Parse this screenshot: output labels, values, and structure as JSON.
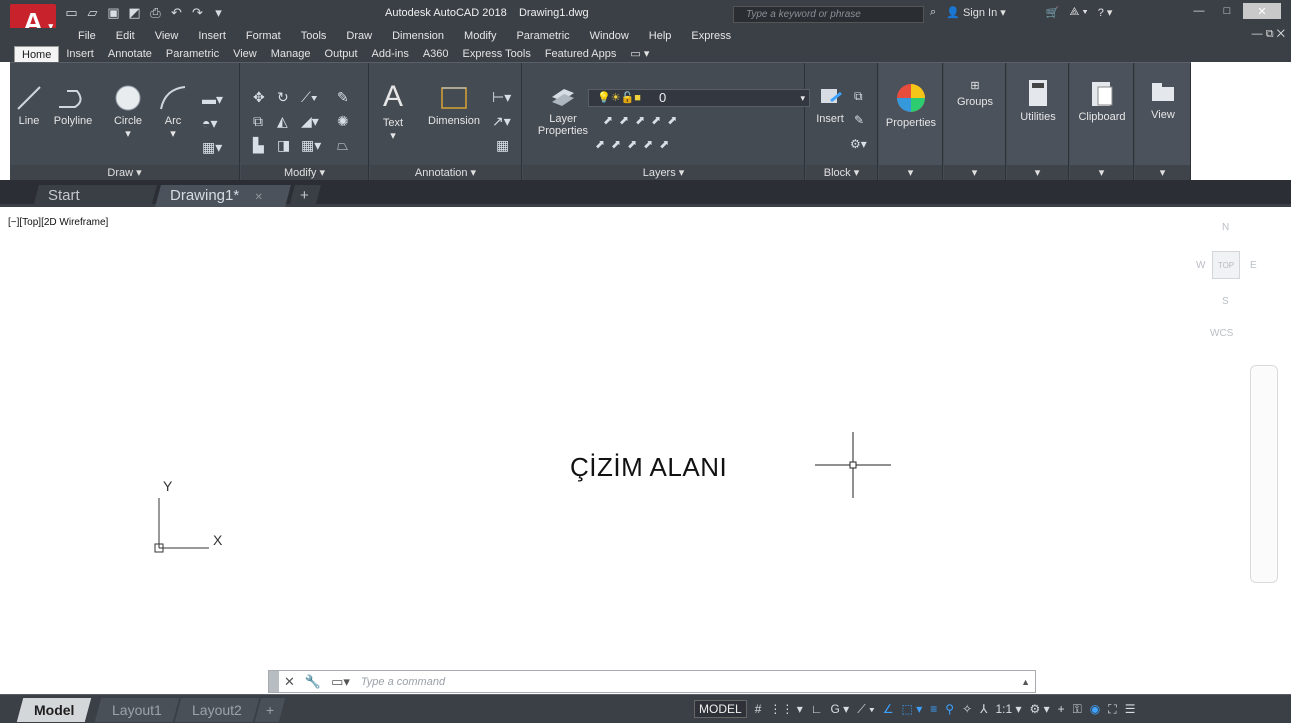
{
  "title": {
    "app_letter": "A",
    "app_name": "Autodesk AutoCAD 2018",
    "file_name": "Drawing1.dwg",
    "search_placeholder": "Type a keyword or phrase",
    "sign_in": "Sign In"
  },
  "menu": [
    "File",
    "Edit",
    "View",
    "Insert",
    "Format",
    "Tools",
    "Draw",
    "Dimension",
    "Modify",
    "Parametric",
    "Window",
    "Help",
    "Express"
  ],
  "ribbon_tabs": [
    "Home",
    "Insert",
    "Annotate",
    "Parametric",
    "View",
    "Manage",
    "Output",
    "Add-ins",
    "A360",
    "Express Tools",
    "Featured Apps"
  ],
  "ribbon": {
    "draw": {
      "line": "Line",
      "polyline": "Polyline",
      "circle": "Circle",
      "arc": "Arc",
      "footer": "Draw ▾"
    },
    "modify": {
      "footer": "Modify ▾"
    },
    "annotation": {
      "text": "Text",
      "dimension": "Dimension",
      "footer": "Annotation ▾"
    },
    "layers": {
      "layer_properties_1": "Layer",
      "layer_properties_2": "Properties",
      "current_layer": "0",
      "footer": "Layers ▾"
    },
    "block": {
      "insert": "Insert",
      "footer": "Block ▾"
    },
    "properties": "Properties",
    "groups": "Groups",
    "utilities": "Utilities",
    "clipboard": "Clipboard",
    "view": "View"
  },
  "file_tabs": {
    "start": "Start",
    "drawing": "Drawing1*",
    "new_tab": "+"
  },
  "viewport": {
    "label": "[−][Top][2D Wireframe]",
    "center_text": "ÇİZİM ALANI",
    "ucs_y": "Y",
    "ucs_x": "X"
  },
  "viewcube": {
    "n": "N",
    "s": "S",
    "e": "E",
    "w": "W",
    "top": "TOP",
    "wcs": "WCS"
  },
  "command": {
    "placeholder": "Type a command"
  },
  "layout_tabs": [
    "Model",
    "Layout1",
    "Layout2"
  ],
  "status": {
    "model": "MODEL",
    "scale": "1:1 ▾"
  }
}
